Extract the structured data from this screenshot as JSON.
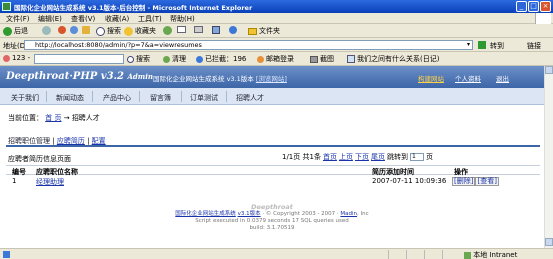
{
  "window": {
    "title": "国际化企业网站生成系统 v3.1版本-后台控制 - Microsoft Internet Explorer",
    "buttons": {
      "minimize": "_",
      "maximize": "□",
      "close": "×"
    }
  },
  "menubar": {
    "items": [
      "文件(F)",
      "编辑(E)",
      "查看(V)",
      "收藏(A)",
      "工具(T)",
      "帮助(H)"
    ]
  },
  "toolbar": {
    "back": "后退",
    "search": "搜索",
    "favorites": "收藏夹",
    "folder": "文件夹"
  },
  "address": {
    "label": "地址(D)",
    "url": "http://localhost:8080/admin/?p=7&a=viewresumes",
    "go": "转到",
    "links": "链接"
  },
  "linksbar": {
    "items": [
      "123 -",
      "搜索",
      "清理",
      "已拦截：196",
      "邮箱登录",
      "截图",
      "我们之间有什么关系(日记)"
    ]
  },
  "app": {
    "logo": "Deepthroat·PHP v3.2",
    "logo_suffix": "Admin",
    "title": "国际化企业网站生成系统 v3.1版本",
    "title_link": "[浏览网站]",
    "header_links": [
      "构建网站",
      "个人资料",
      "退出"
    ],
    "nav": [
      "关于我们",
      "新闻动态",
      "产品中心",
      "留言簿",
      "订单测试",
      "招聘人才"
    ],
    "breadcrumb": {
      "prefix": "当前位置：",
      "home": "首 页",
      "sep": "→",
      "current": "招聘人才"
    },
    "subtabs": [
      "招聘职位管理",
      "|",
      "应聘简历",
      "|",
      "配置"
    ],
    "table_title": "应聘者简历信息页面",
    "pager": {
      "summary": "1/1页 共1条",
      "first": "首页",
      "prev": "上页",
      "next": "下页",
      "last": "尾页",
      "goto": "跳转到",
      "page_value": "1",
      "page_suffix": "页"
    },
    "columns": [
      "编号",
      "应聘职位名称",
      "简历添加时间",
      "操作"
    ],
    "rows": [
      {
        "id": "1",
        "position": "经理助理",
        "time": "2007-07-11 10:09:36",
        "delete": "[删除]",
        "view": "[查看]"
      }
    ],
    "footer": {
      "brand": "Deepthroat",
      "line1_a": "国际化企业网站生成系统",
      "line1_b": "v3.1版本",
      "line1_c": "· © Copyright 2003 - 2007 ·",
      "line1_d": "Madin",
      "line1_e": ", Inc",
      "line2": "Script executed in 0.0379 seconds 17 SQL queries used",
      "line3": "build: 3.1.70519"
    }
  },
  "statusbar": {
    "zone": "本地 Intranet"
  },
  "colors": {
    "titlebar": "#0a3fb8",
    "app_header": "#3d66a8",
    "link": "#1a33aa",
    "nav_bg": "#dbe5f3"
  }
}
